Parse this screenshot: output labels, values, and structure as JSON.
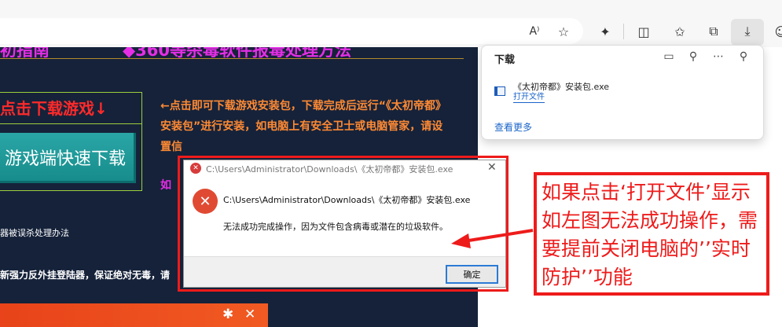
{
  "browser": {
    "toolbar_icons": [
      "read-aloud-icon",
      "favorite-star-icon",
      "extensions-icon",
      "split-screen-icon",
      "favorites-icon",
      "collections-icon",
      "downloads-icon",
      "copilot-icon"
    ],
    "read_aloud_label": "A⁾"
  },
  "webpage": {
    "nav_left": "初指南",
    "nav_right": "◆360等杀毒软件报毒处理方法",
    "click_title": "点击下载游戏↓",
    "download_button": "游戏端快速下载",
    "instructions": "←点击即可下载游戏安装包，下载完成后运行“《太初帝都》安装包”进行安装，如电脑上有安全卫士或电脑管家，请设置信",
    "magenta_fragment": "如",
    "text_line1": "器被误杀处理办法",
    "text_line2": "新强力反外挂登陆器，保证绝对无毒，请",
    "bar_icons": [
      "gear-icon",
      "close-icon"
    ]
  },
  "downloads_panel": {
    "title": "下载",
    "file_name": "《太初帝都》安装包.exe",
    "open_file": "打开文件",
    "see_more": "查看更多"
  },
  "dialog": {
    "title": "C:\\Users\\Administrator\\Downloads\\《太初帝都》安装包.exe",
    "path": "C:\\Users\\Administrator\\Downloads\\《太初帝都》安装包.exe",
    "message": "无法成功完成操作，因为文件包含病毒或潜在的垃圾软件。",
    "ok_label": "确定"
  },
  "annotation": {
    "text": "如果点击‘打开文件’显示如左图无法成功操作，需要提前关闭电脑的’’实时防护’’功能"
  },
  "colors": {
    "annotation_red": "#ee1b1b",
    "page_bg": "#15223a",
    "link_blue": "#1a64c8",
    "nav_magenta": "#e52ee5",
    "instruction_orange": "#ff8a33"
  }
}
